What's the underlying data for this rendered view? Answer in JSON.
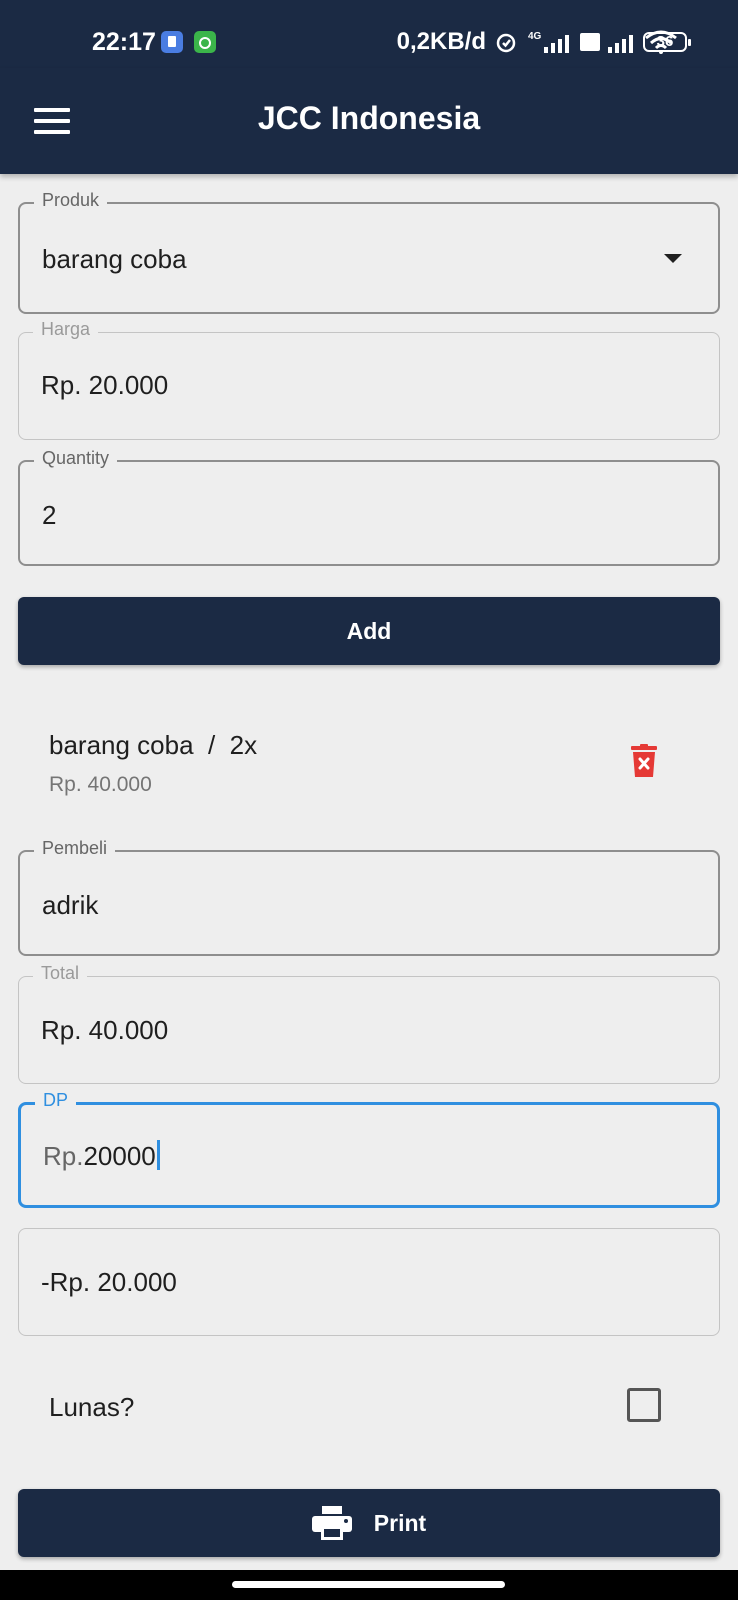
{
  "status_bar": {
    "time": "22:17",
    "network_speed": "0,2KB/d",
    "signal_label": "4G",
    "volte_label": "Vo LTE",
    "battery": "36"
  },
  "app_bar": {
    "title": "JCC Indonesia",
    "menu_icon": "hamburger-menu-icon"
  },
  "form": {
    "produk": {
      "label": "Produk",
      "value": "barang coba"
    },
    "harga": {
      "label": "Harga",
      "value": "Rp. 20.000"
    },
    "quantity": {
      "label": "Quantity",
      "value": "2"
    },
    "add_button": "Add"
  },
  "cart": {
    "items": [
      {
        "title": "barang coba  /  2x",
        "subtotal": "Rp. 40.000",
        "delete_icon": "trash-icon"
      }
    ]
  },
  "checkout": {
    "pembeli": {
      "label": "Pembeli",
      "value": "adrik"
    },
    "total": {
      "label": "Total",
      "value": "Rp. 40.000"
    },
    "dp": {
      "label": "DP",
      "prefix": "Rp.",
      "value": "20000"
    },
    "sisa": {
      "value": "-Rp. 20.000"
    },
    "lunas_label": "Lunas?",
    "lunas_checked": false,
    "print_button": "Print",
    "print_icon": "printer-icon"
  },
  "colors": {
    "primary": "#1b2a44",
    "background": "#eeeeee",
    "focus": "#2f8fe0",
    "danger": "#e53935"
  }
}
